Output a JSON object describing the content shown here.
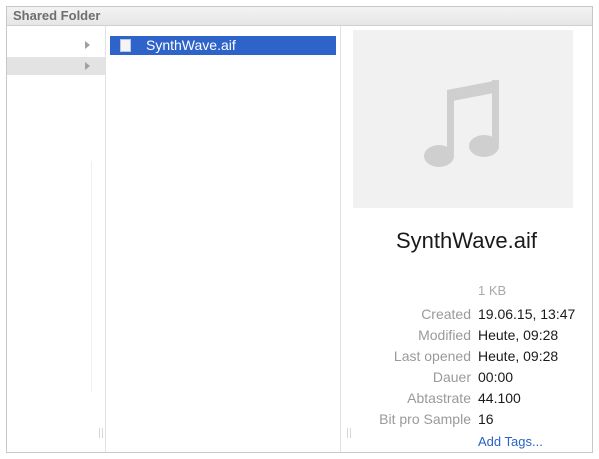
{
  "window": {
    "title": "Shared Folder"
  },
  "column1": {
    "icons": [
      "disclosure-arrow",
      "disclosure-arrow"
    ]
  },
  "column2": {
    "selected_file": "SynthWave.aif",
    "file_icon": "audio-file-icon"
  },
  "preview": {
    "icon": "music-note-icon",
    "file_name": "SynthWave.aif",
    "size": "1 KB",
    "info": [
      {
        "label": "Created",
        "value": "19.06.15, 13:47"
      },
      {
        "label": "Modified",
        "value": "Heute, 09:28"
      },
      {
        "label": "Last opened",
        "value": "Heute, 09:28"
      },
      {
        "label": "Dauer",
        "value": "00:00"
      },
      {
        "label": "Abtastrate",
        "value": "44.100"
      },
      {
        "label": "Bit pro Sample",
        "value": "16"
      }
    ],
    "add_tags": "Add Tags..."
  },
  "colors": {
    "selection": "#2e63c9",
    "link": "#2a62c6"
  }
}
